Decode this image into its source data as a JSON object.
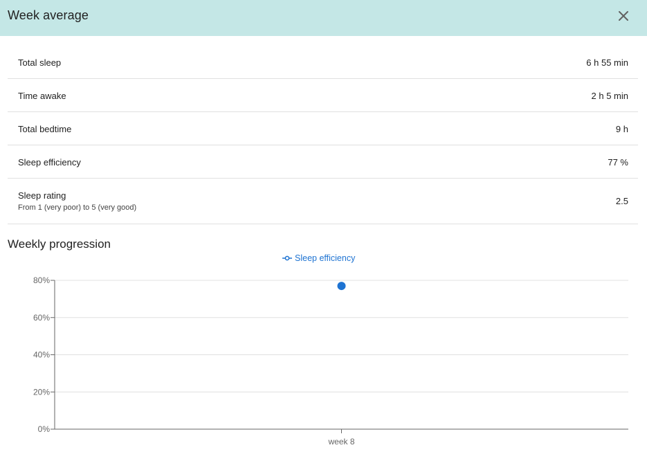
{
  "header": {
    "title": "Week average"
  },
  "stats": [
    {
      "label": "Total sleep",
      "value": "6 h 55 min"
    },
    {
      "label": "Time awake",
      "value": "2 h 5 min"
    },
    {
      "label": "Total bedtime",
      "value": "9 h"
    },
    {
      "label": "Sleep efficiency",
      "value": "77 %"
    },
    {
      "label": "Sleep rating",
      "sublabel": "From 1 (very poor) to 5 (very good)",
      "value": "2.5"
    }
  ],
  "progression": {
    "title": "Weekly progression"
  },
  "icons": {
    "close": "close-icon",
    "legend_marker": "line-point-icon"
  },
  "colors": {
    "header_bg": "#c4e7e6",
    "series": "#1e73d2",
    "grid": "#e0e0e0"
  },
  "chart_data": {
    "type": "line",
    "categories": [
      "week 8"
    ],
    "series": [
      {
        "name": "Sleep efficiency",
        "values": [
          77
        ]
      }
    ],
    "yticks": [
      "0%",
      "20%",
      "40%",
      "60%",
      "80%"
    ],
    "ylim": [
      0,
      80
    ],
    "grid": true,
    "legend": "top-center"
  }
}
